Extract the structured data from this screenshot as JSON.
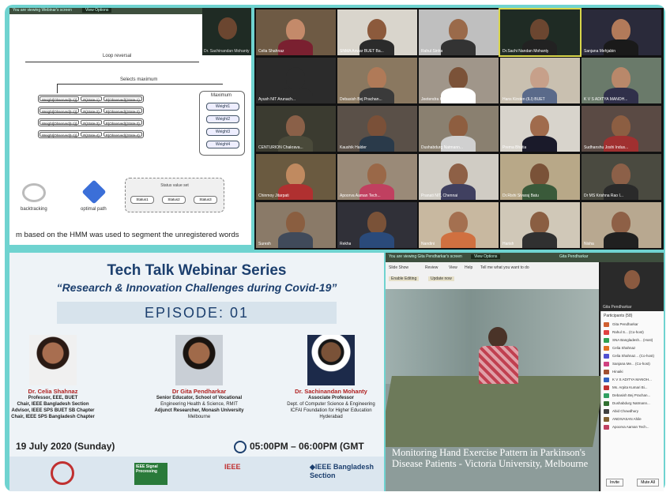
{
  "diagram": {
    "topbar_left": "You are viewing Webinar's screen",
    "topbar_btn": "View Options",
    "presenter_name": "Dr. Sachinandan Mohanty",
    "loop_reversal": "Loop reversal",
    "select_maximum": "Selects maximum",
    "rows": [
      [
        "Weight[Observed(t-1)]",
        "P(State-1)",
        "P(Observed)(State-1)"
      ],
      [
        "Weight[Observed(t-1)]",
        "P(State-2)",
        "P(Observed)(State-2)"
      ],
      [
        "Weight[Observed(t-1)]",
        "P(State-3)",
        "P(Observed)(State-3)"
      ],
      [
        "Weight[Observed(t-1)]",
        "P(State-4)",
        "P(Observed)(State-4)"
      ]
    ],
    "maximum_label": "Maximum",
    "weights": [
      "Weight1",
      "Weight2",
      "Weight3",
      "Weight4"
    ],
    "state_box_title": "Status value set",
    "states": [
      "Status1",
      "Status2",
      "Status3"
    ],
    "backtracking": "backtracking",
    "optimal_path": "optimal path",
    "caption": "m based on the HMM was used to segment the unregistered words"
  },
  "gallery": {
    "tiles": [
      {
        "name": "Celia Shahnaz",
        "bg": "#6e5a44",
        "skin": "#c48a6a",
        "shirt": "#7a2030"
      },
      {
        "name": "SNMA Anwar BUET Ba...",
        "bg": "#d9d5cc",
        "skin": "#8c5a3c",
        "shirt": "#2b2b2b"
      },
      {
        "name": "Rahul Sinha",
        "bg": "#bfbfbf",
        "skin": "#9a6a4a",
        "shirt": "#333"
      },
      {
        "name": "Dr.Sachi Nandan Mohanty",
        "bg": "#1f2b24",
        "skin": "#6b4630",
        "shirt": "#222",
        "active": true
      },
      {
        "name": "Sanjana Mehjabin",
        "bg": "#2a2a3a",
        "skin": "#b27a5a",
        "shirt": "#1a1a1a"
      },
      {
        "name": "Ayush NIT Arunach...",
        "bg": "#2b2b2b",
        "skin": "#2b2b2b",
        "shirt": "#2b2b2b"
      },
      {
        "name": "Debasish Bej Prachan...",
        "bg": "#8a7860",
        "skin": "#b07a58",
        "shirt": "#3a3a3a"
      },
      {
        "name": "Jeetendra Kumar Bhitgya...",
        "bg": "#a0968a",
        "skin": "#7b5238",
        "shirt": "#fff"
      },
      {
        "name": "Hans Kirsten (ILI) BUET",
        "bg": "#c9c0b0",
        "skin": "#c7a08a",
        "shirt": "#5a6a8a"
      },
      {
        "name": "K V S ADITYA MANOH...",
        "bg": "#6a7a6a",
        "skin": "#b9886a",
        "shirt": "#30304a"
      },
      {
        "name": "CENTURION Chakrava...",
        "bg": "#3b3b30",
        "skin": "#8a6048",
        "shirt": "#4a4a3a"
      },
      {
        "name": "Kaushik Halder",
        "bg": "#5a5048",
        "skin": "#7a5038",
        "shirt": "#2a3a4a"
      },
      {
        "name": "Dushabdurg Natmann...",
        "bg": "#8a8070",
        "skin": "#8e5e40",
        "shirt": "#d0d0d0"
      },
      {
        "name": "Prema Bhatia",
        "bg": "#d8d4cc",
        "skin": "#a06b4c",
        "shirt": "#1a1a2a"
      },
      {
        "name": "Sudhanshu Joshi Indus...",
        "bg": "#5a4a44",
        "skin": "#8c5e42",
        "shirt": "#a03030"
      },
      {
        "name": "Chinmoy Jitarpati",
        "bg": "#6a5a40",
        "skin": "#c08a60",
        "shirt": "#b03030"
      },
      {
        "name": "Apoorva Aaman Tech...",
        "bg": "#9a8a78",
        "skin": "#9a6848",
        "shirt": "#c04060"
      },
      {
        "name": "Pranati NIT, Chennai",
        "bg": "#d0ccc4",
        "skin": "#8e6046",
        "shirt": "#404060"
      },
      {
        "name": "Dr.Rishi Sivaraj Batu",
        "bg": "#b8a888",
        "skin": "#7a5238",
        "shirt": "#3a5a3a"
      },
      {
        "name": "Dr MS Krishna Rao I...",
        "bg": "#4a4a40",
        "skin": "#8c6048",
        "shirt": "#2a2a2a"
      },
      {
        "name": "Suresh",
        "bg": "#8a7a68",
        "skin": "#8a5e40",
        "shirt": "#404a5a"
      },
      {
        "name": "Rekha",
        "bg": "#303038",
        "skin": "#7a5238",
        "shirt": "#2a4a7a"
      },
      {
        "name": "Nandini",
        "bg": "#c8b8a0",
        "skin": "#a47050",
        "shirt": "#d07040"
      },
      {
        "name": "Harish",
        "bg": "#d0c8b8",
        "skin": "#8a5e42",
        "shirt": "#303030"
      },
      {
        "name": "Nisha",
        "bg": "#b8a890",
        "skin": "#8e6046",
        "shirt": "#202020"
      }
    ]
  },
  "poster": {
    "title": "Tech Talk Webinar Series",
    "subtitle": "“Research & Innovation Challenges during Covid-19”",
    "episode": "EPISODE: 01",
    "speakers": [
      {
        "name": "Dr. Celia Shahnaz",
        "lines": [
          "Professor, EEE, BUET",
          "Chair, IEEE Bangladesh Section",
          "Advisor, IEEE SPS BUET SB Chapter",
          "Chair, IEEE SPS Bangladesh Chapter"
        ]
      },
      {
        "name": "Dr Gita Pendharkar",
        "lines": [
          "Senior Educator, School of Vocational",
          "Engineering Health & Science, RMIT",
          "Adjunct Researcher, Monash University",
          "Melbourne"
        ]
      },
      {
        "name": "Dr. Sachinandan Mohanty",
        "lines": [
          "Associate Professor",
          "Dept. of Computer Science & Engineering",
          "ICFAI Foundation for Higher Education",
          "Hyderabad"
        ]
      }
    ],
    "date": "19 July 2020 (Sunday)",
    "time": "05:00PM – 06:00PM (GMT",
    "logos": [
      "IEEE Signal Processing",
      "IEEE",
      "◆IEEE Bangladesh Section"
    ]
  },
  "share": {
    "bar_left": "You are viewing Gita Pendharkar's screen",
    "bar_btn": "View Options",
    "bar_right": "Gita Pendharkar",
    "ribbon_items": [
      "Slide Show",
      "Review",
      "View",
      "Help",
      "Tell me what you want to do"
    ],
    "ribbon_row2": [
      "Enable Editing",
      "Update now"
    ],
    "cam_name": "Gita Pendharkar",
    "participants_title": "Participants (58)",
    "participants": [
      {
        "name": "Gita Pendharkar",
        "c": "#d06030"
      },
      {
        "name": "Rahul S... (Co-host)",
        "c": "#e04040"
      },
      {
        "name": "SNA Bangladesh... (Host)",
        "c": "#30a050"
      },
      {
        "name": "Celia Shahnaz",
        "c": "#e07020"
      },
      {
        "name": "Celia Shahnaz... (Co-host)",
        "c": "#5050d0"
      },
      {
        "name": "Sanjana Me... (Co-host)",
        "c": "#d04080"
      },
      {
        "name": "Hinaiki",
        "c": "#a05030"
      },
      {
        "name": "K V S ADITYA MANOH...",
        "c": "#3060c0"
      },
      {
        "name": "Ms. Arpita Kumari Bi...",
        "c": "#c03030"
      },
      {
        "name": "Debasish Bej Prachan...",
        "c": "#30a060"
      },
      {
        "name": "Dushabdurg Natmann...",
        "c": "#307030"
      },
      {
        "name": "Abid Chowdhury",
        "c": "#404040"
      },
      {
        "name": "ANDIVASAN Ahile",
        "c": "#806030"
      },
      {
        "name": "Apoorva Aaman Tech...",
        "c": "#c04060"
      }
    ],
    "footer_left": "Invite",
    "footer_right": "Mute All",
    "caption": "Monitoring Hand Exercise Pattern in Parkinson's Disease Patients - Victoria University, Melbourne"
  }
}
